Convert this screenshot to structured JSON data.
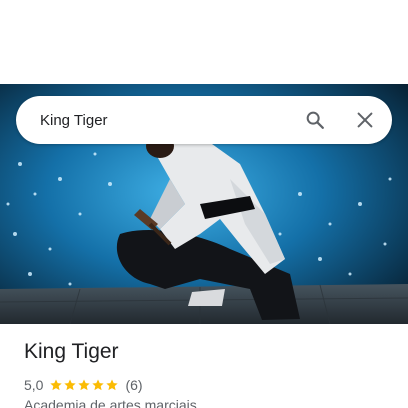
{
  "search": {
    "value": "King Tiger",
    "search_icon": "search-icon",
    "close_icon": "close-icon"
  },
  "place": {
    "title": "King Tiger",
    "rating": "5,0",
    "stars_filled": 5,
    "stars_total": 5,
    "review_count": "(6)",
    "category": "Academia de artes marciais"
  },
  "colors": {
    "star": "#fbbc04",
    "icon": "#5f6368",
    "title": "#202124",
    "secondary": "#5f6368"
  }
}
